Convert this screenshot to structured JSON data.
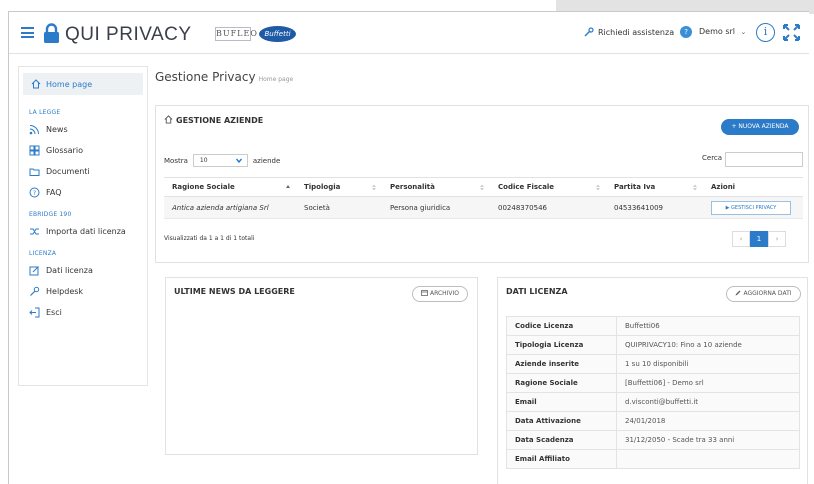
{
  "header": {
    "app_name": "QUI PRIVACY",
    "buff_logo": "BUFLEO",
    "partner_logo": "Buffetti",
    "assist_label": "Richiedi assistenza",
    "assist_badge": "?",
    "company": "Demo srl",
    "info_glyph": "i"
  },
  "sidebar": {
    "home": "Home page",
    "sections": [
      {
        "title": "LA LEGGE",
        "items": [
          "News",
          "Glossario",
          "Documenti",
          "FAQ"
        ]
      },
      {
        "title": "EBRIDGE 190",
        "items": [
          "Importa dati licenza"
        ]
      },
      {
        "title": "LICENZA",
        "items": [
          "Dati licenza",
          "Helpdesk",
          "Esci"
        ]
      }
    ]
  },
  "page": {
    "title": "Gestione Privacy",
    "crumb": "Home page"
  },
  "aziende": {
    "title": "GESTIONE AZIENDE",
    "new_button": "+ NUOVA AZIENDA",
    "show_label": "Mostra",
    "show_value": "10",
    "show_suffix": "aziende",
    "search_label": "Cerca",
    "columns": [
      "Ragione Sociale",
      "Tipologia",
      "Personalità",
      "Codice Fiscale",
      "Partita Iva",
      "Azioni"
    ],
    "rows": [
      {
        "ragione": "Antica azienda artigiana Srl",
        "tipologia": "Società",
        "personalita": "Persona giuridica",
        "cf": "00248370546",
        "piva": "04533641009",
        "action": "▶ GESTISCI PRIVACY"
      }
    ],
    "footer": "Visualizzati da 1 a 1 di 1 totali",
    "pager": [
      "‹",
      "1",
      "›"
    ]
  },
  "news": {
    "title": "ULTIME NEWS DA LEGGERE",
    "archive_button": "ARCHIVIO"
  },
  "licenza": {
    "title": "DATI LICENZA",
    "update_button": "AGGIORNA DATI",
    "rows": [
      {
        "k": "Codice Licenza",
        "v": "Buffetti06"
      },
      {
        "k": "Tipologia Licenza",
        "v": "QUIPRIVACY10: Fino a 10 aziende"
      },
      {
        "k": "Aziende inserite",
        "v": "1 su 10 disponibili"
      },
      {
        "k": "Ragione Sociale",
        "v": "[Buffetti06] - Demo srl"
      },
      {
        "k": "Email",
        "v": "d.visconti@buffetti.it"
      },
      {
        "k": "Data Attivazione",
        "v": "24/01/2018"
      },
      {
        "k": "Data Scadenza",
        "v": "31/12/2050 - Scade tra 33 anni"
      },
      {
        "k": "Email Affiliato",
        "v": ""
      }
    ]
  },
  "colors": {
    "accent": "#2b7bc9",
    "text": "#333333",
    "border": "#e2e2e2"
  }
}
